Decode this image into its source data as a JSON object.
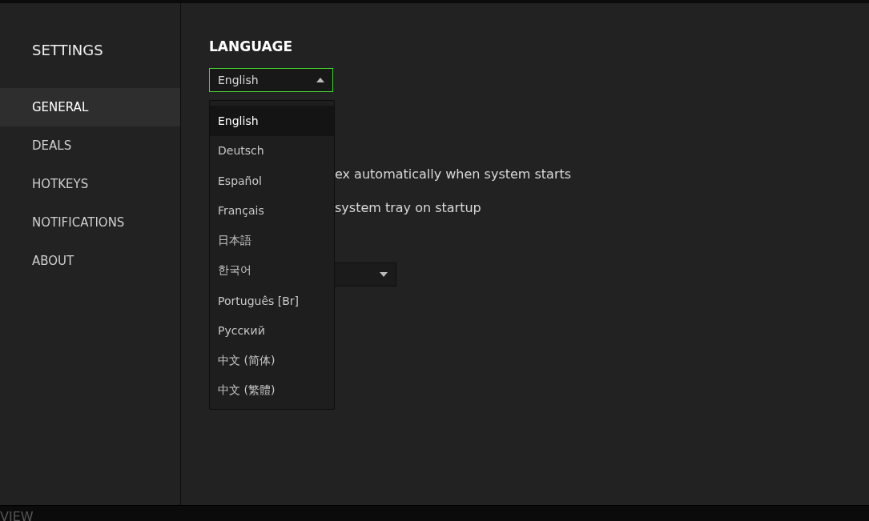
{
  "sidebar": {
    "title": "SETTINGS",
    "items": [
      {
        "label": "GENERAL",
        "selected": true
      },
      {
        "label": "DEALS",
        "selected": false
      },
      {
        "label": "HOTKEYS",
        "selected": false
      },
      {
        "label": "NOTIFICATIONS",
        "selected": false
      },
      {
        "label": "ABOUT",
        "selected": false
      }
    ]
  },
  "language": {
    "heading": "LANGUAGE",
    "value": "English",
    "expanded": true,
    "options": [
      {
        "label": "English",
        "selected": true
      },
      {
        "label": "Deutsch",
        "selected": false
      },
      {
        "label": "Español",
        "selected": false
      },
      {
        "label": "Français",
        "selected": false
      },
      {
        "label": "日本語",
        "selected": false
      },
      {
        "label": "한국어",
        "selected": false
      },
      {
        "label": "Português [Br]",
        "selected": false
      },
      {
        "label": "Русский",
        "selected": false
      },
      {
        "label": "中文 (简体)",
        "selected": false
      },
      {
        "label": "中文 (繁體)",
        "selected": false
      }
    ]
  },
  "startup_options": [
    "ex automatically when system starts",
    "system tray on startup"
  ],
  "bottom_bar": {
    "label": "VIEW"
  }
}
